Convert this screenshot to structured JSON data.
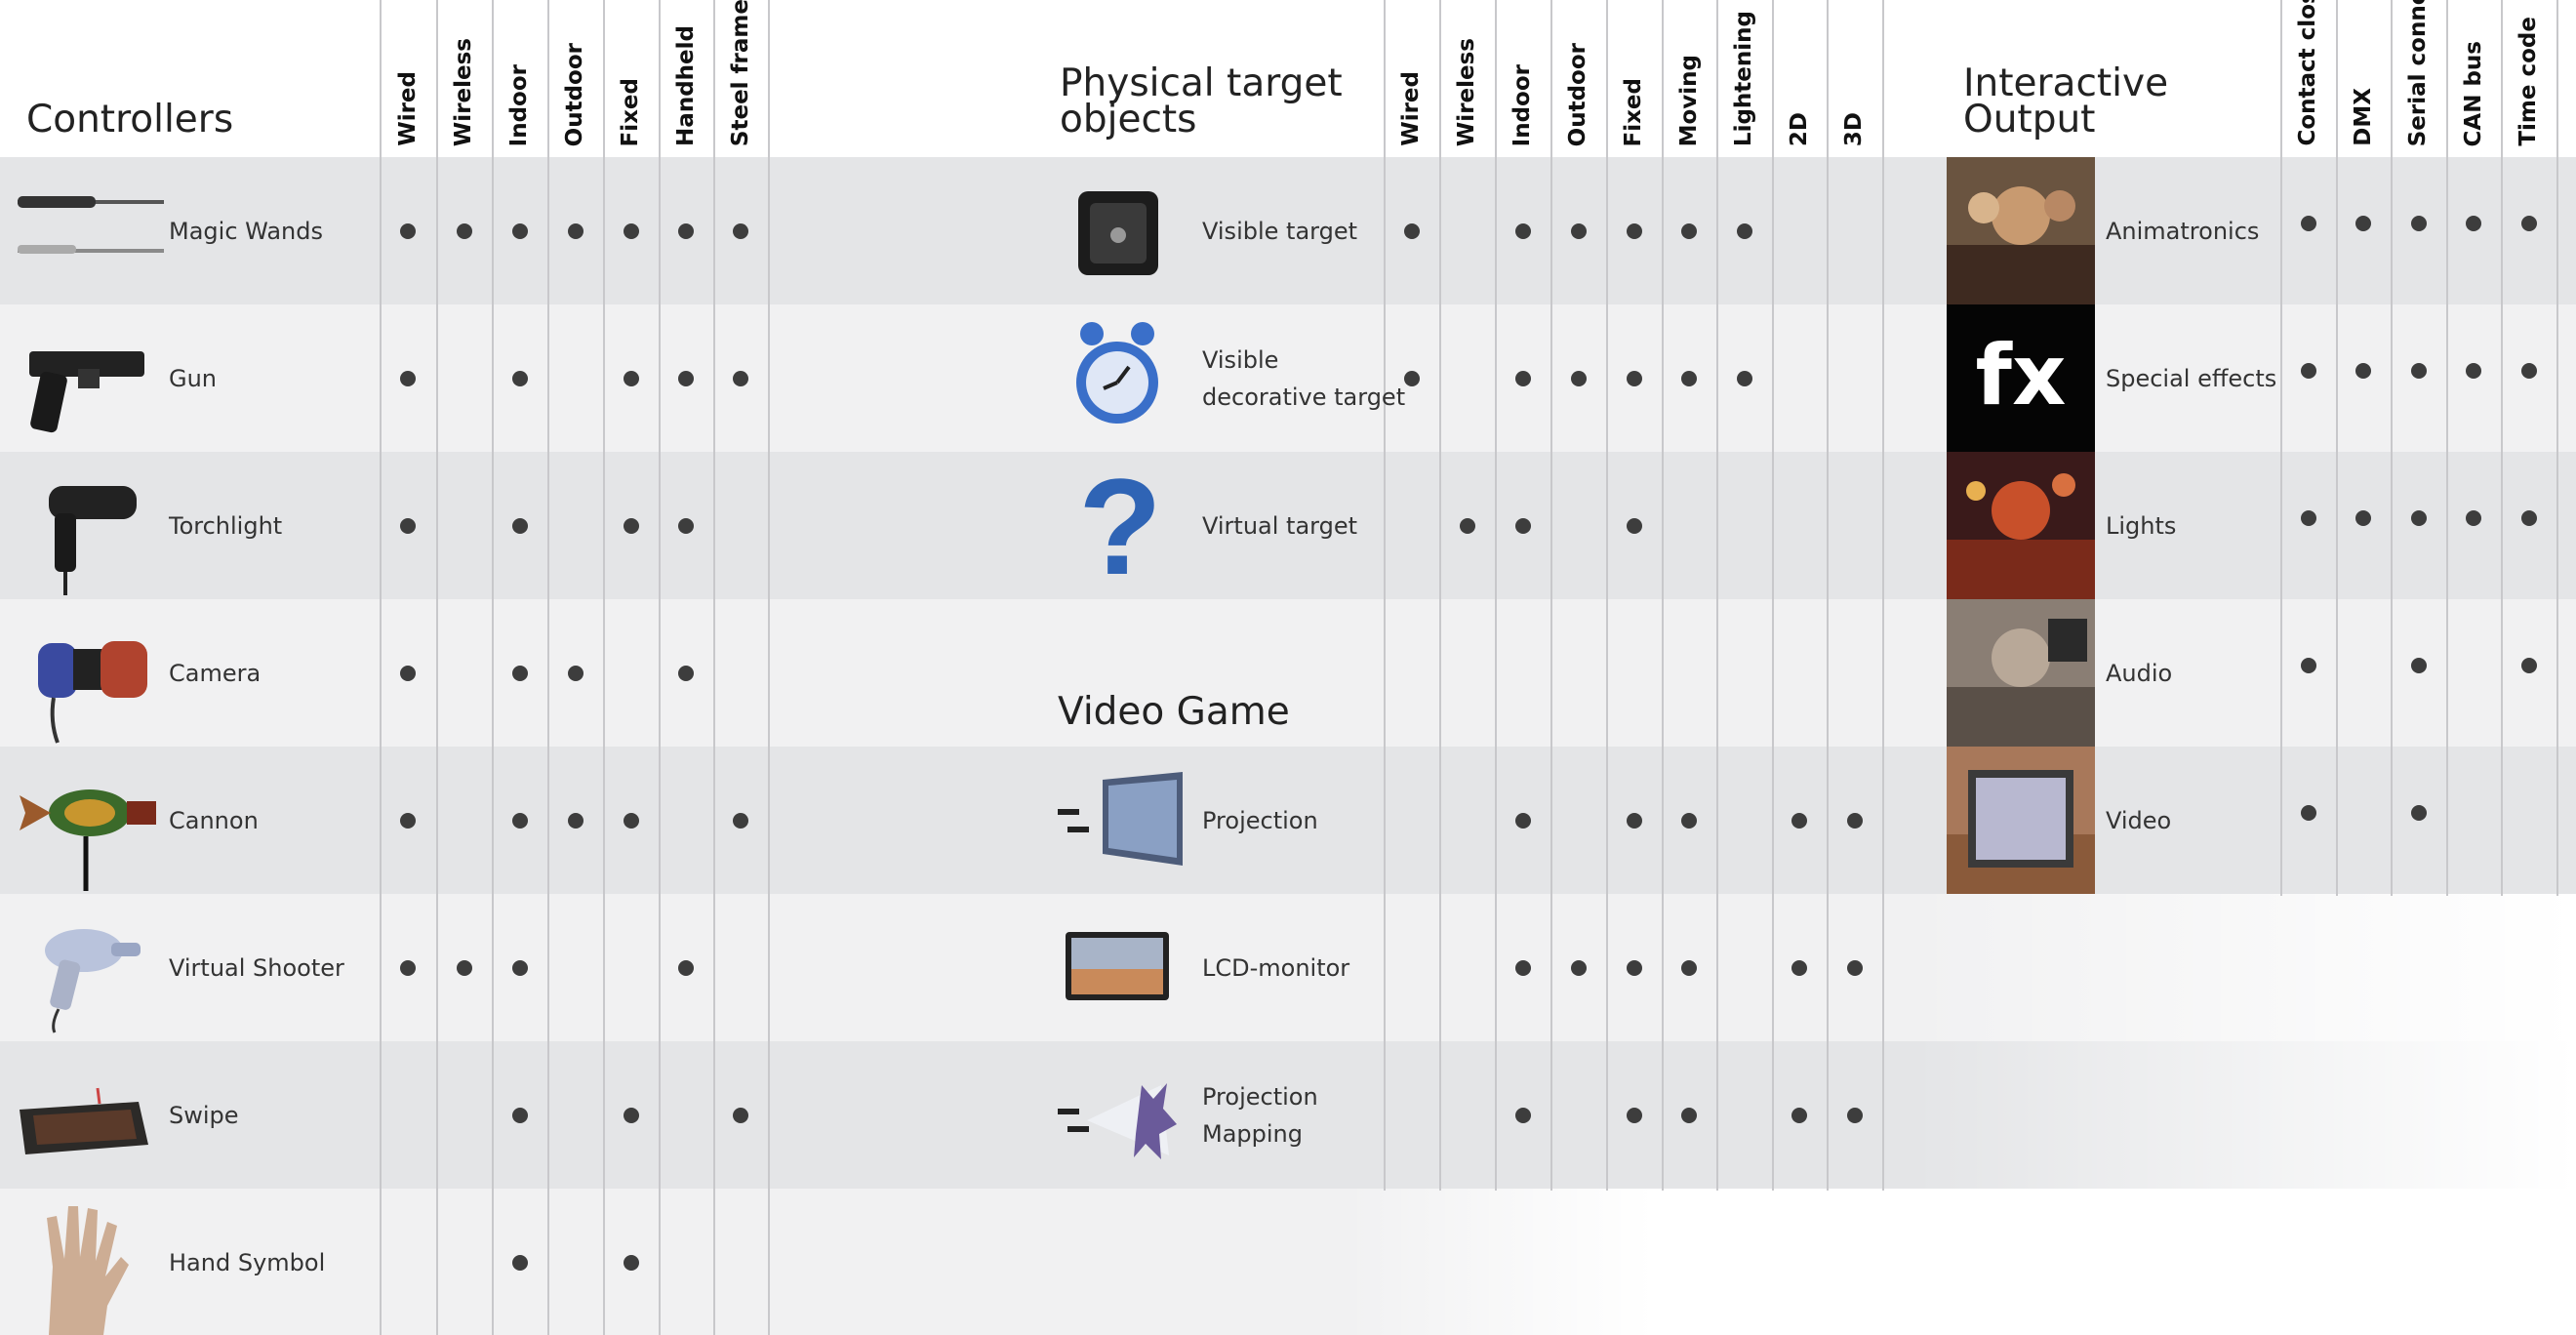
{
  "sections": {
    "controllers": {
      "title": "Controllers",
      "columns": [
        "Wired",
        "Wireless",
        "Indoor",
        "Outdoor",
        "Fixed",
        "Handheld",
        "Steel frame"
      ],
      "rows": [
        {
          "label": "Magic Wands",
          "icon": "magic-wand-icon",
          "marks": [
            1,
            1,
            1,
            1,
            1,
            1,
            1
          ]
        },
        {
          "label": "Gun",
          "icon": "gun-icon",
          "marks": [
            1,
            0,
            1,
            0,
            1,
            1,
            1
          ]
        },
        {
          "label": "Torchlight",
          "icon": "torchlight-icon",
          "marks": [
            1,
            0,
            1,
            0,
            1,
            1,
            0
          ]
        },
        {
          "label": "Camera",
          "icon": "camera-icon",
          "marks": [
            1,
            0,
            1,
            1,
            0,
            1,
            0
          ]
        },
        {
          "label": "Cannon",
          "icon": "cannon-icon",
          "marks": [
            1,
            0,
            1,
            1,
            1,
            0,
            1
          ]
        },
        {
          "label": "Virtual Shooter",
          "icon": "virtual-shooter-icon",
          "marks": [
            1,
            1,
            1,
            0,
            0,
            1,
            0
          ]
        },
        {
          "label": "Swipe",
          "icon": "swipe-icon",
          "marks": [
            0,
            0,
            1,
            0,
            1,
            0,
            1
          ]
        },
        {
          "label": "Hand Symbol",
          "icon": "hand-icon",
          "marks": [
            0,
            0,
            1,
            0,
            1,
            0,
            0
          ]
        }
      ]
    },
    "targets": {
      "title": "Physical target\nobjects",
      "video_title": "Video Game",
      "columns": [
        "Wired",
        "Wireless",
        "Indoor",
        "Outdoor",
        "Fixed",
        "Moving",
        "Lightening",
        "2D",
        "3D"
      ],
      "rows": [
        {
          "label": "Visible target",
          "icon": "visible-target-icon",
          "marks": [
            1,
            0,
            1,
            1,
            1,
            1,
            1,
            0,
            0
          ]
        },
        {
          "label": "Visible\ndecorative target",
          "icon": "alarm-clock-icon",
          "marks": [
            1,
            0,
            1,
            1,
            1,
            1,
            1,
            0,
            0
          ]
        },
        {
          "label": "Virtual target",
          "icon": "question-mark-icon",
          "marks": [
            0,
            1,
            1,
            0,
            1,
            0,
            0,
            0,
            0
          ]
        },
        {
          "label": "",
          "icon": "",
          "marks": [
            0,
            0,
            0,
            0,
            0,
            0,
            0,
            0,
            0
          ]
        },
        {
          "label": "Projection",
          "icon": "projection-icon",
          "marks": [
            0,
            0,
            1,
            0,
            1,
            1,
            0,
            1,
            1
          ]
        },
        {
          "label": "LCD-monitor",
          "icon": "lcd-monitor-icon",
          "marks": [
            0,
            0,
            1,
            1,
            1,
            1,
            0,
            1,
            1
          ]
        },
        {
          "label": "Projection\nMapping",
          "icon": "projection-mapping-icon",
          "marks": [
            0,
            0,
            1,
            0,
            1,
            1,
            0,
            1,
            1
          ]
        }
      ]
    },
    "output": {
      "title": "Interactive\nOutput",
      "columns": [
        "Contact closure",
        "DMX",
        "Serial connection",
        "CAN bus",
        "Time code"
      ],
      "rows": [
        {
          "label": "Animatronics",
          "icon": "animatronics-photo",
          "marks": [
            1,
            1,
            1,
            1,
            1
          ]
        },
        {
          "label": "Special effects",
          "icon": "fx-icon",
          "fx_text": "fx",
          "marks": [
            1,
            1,
            1,
            1,
            1
          ]
        },
        {
          "label": "Lights",
          "icon": "lights-photo",
          "marks": [
            1,
            1,
            1,
            1,
            1
          ]
        },
        {
          "label": "Audio",
          "icon": "audio-photo",
          "marks": [
            1,
            0,
            1,
            0,
            1
          ]
        },
        {
          "label": "Video",
          "icon": "video-photo",
          "marks": [
            1,
            0,
            1,
            0,
            0
          ]
        }
      ]
    }
  },
  "colors": {
    "band_dark": "#e4e5e7",
    "band_light": "#f1f1f2",
    "dot": "#3d3d3d",
    "rule": "#c8c8cb"
  }
}
